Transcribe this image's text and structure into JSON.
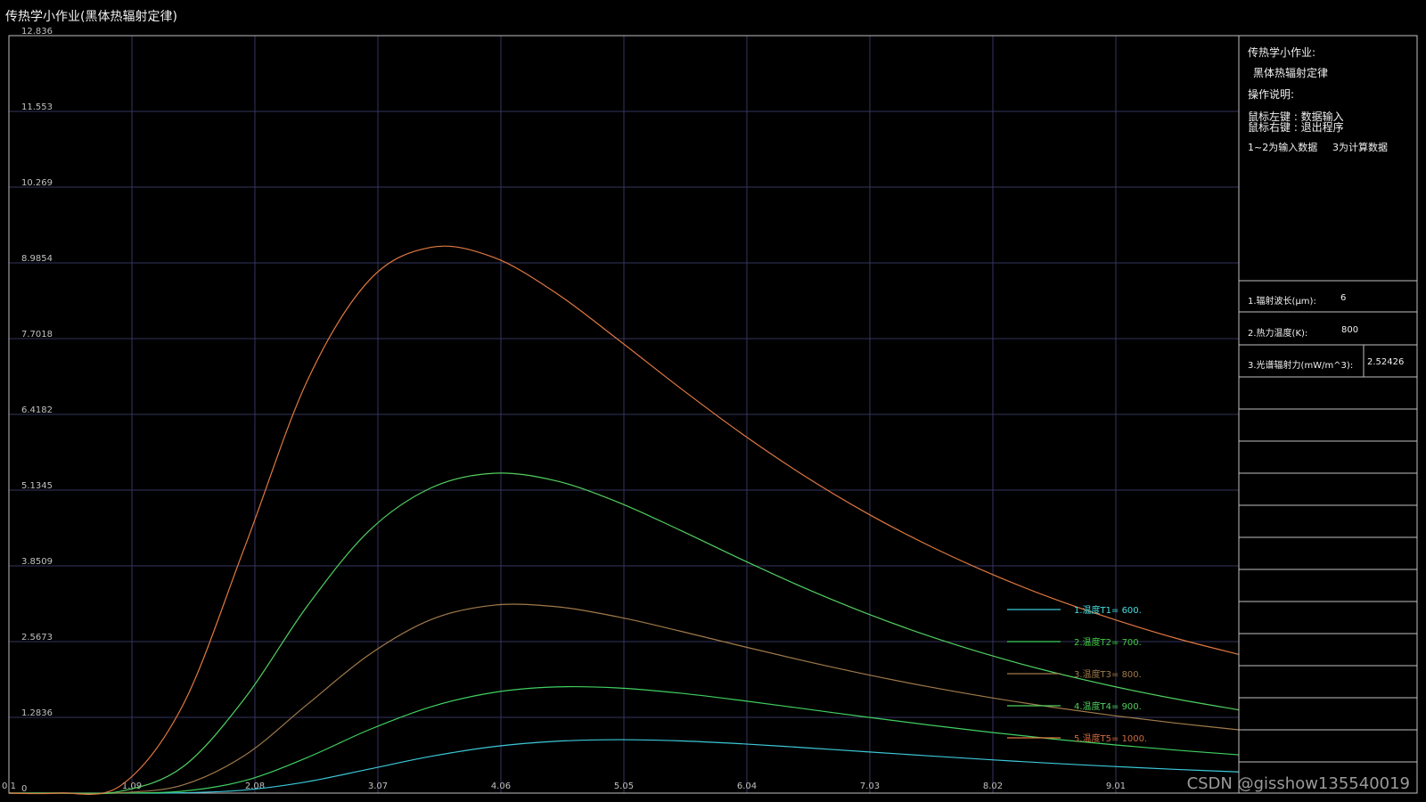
{
  "window": {
    "title": "传热学小作业(黑体热辐射定律)"
  },
  "sidebar": {
    "heading": "传热学小作业:",
    "subheading": "黑体热辐射定律",
    "instructions_label": "操作说明:",
    "left_click": "鼠标左键  : 数据输入",
    "right_click": "鼠标右键  : 退出程序",
    "note_inputs": "1~2为输入数据",
    "note_calc": "3为计算数据",
    "fields": [
      {
        "label": "1.辐射波长(μm):",
        "value": "6"
      },
      {
        "label": "2.热力温度(K):",
        "value": "800"
      },
      {
        "label": "3.光谱辐射力(mW/m^3):",
        "value": "2.52426"
      }
    ]
  },
  "watermark": "CSDN @gisshow135540019",
  "colors": {
    "background": "#000000",
    "grid": "#353560",
    "axis": "#c0c0c0",
    "label": "#c0c0c0",
    "legend_text_1": "#47e0e0",
    "legend_text_2": "#40d040",
    "legend_text_3": "#a07a4a",
    "legend_text_4": "#50d060",
    "legend_text_5": "#d06a40"
  },
  "chart_data": {
    "type": "line",
    "title": "",
    "xlabel": "",
    "ylabel": "",
    "xlim": [
      0.1,
      10.0
    ],
    "ylim": [
      0,
      12.836
    ],
    "x_ticks": [
      "0.1",
      "1.09",
      "2.08",
      "3.07",
      "4.06",
      "5.05",
      "6.04",
      "7.03",
      "8.02",
      "9.01"
    ],
    "y_ticks": [
      "0",
      "1.2836",
      "2.5673",
      "3.8509",
      "5.1345",
      "6.4182",
      "7.7018",
      "8.9854",
      "10.269",
      "11.553",
      "12.836"
    ],
    "grid": true,
    "legend_position": "bottom-right",
    "series": [
      {
        "name": "1.温度T1=  600.",
        "temperature": 600,
        "color": "#3cc8d8",
        "x": [
          0.5,
          1.0,
          1.5,
          2.0,
          2.5,
          3.0,
          3.5,
          4.0,
          4.5,
          5.0,
          5.5,
          6.0,
          6.5,
          7.0,
          7.5,
          8.0,
          8.5,
          9.0,
          9.5,
          10.0
        ],
        "values": [
          0,
          6e-05,
          0.0051,
          0.0518,
          0.1918,
          0.4071,
          0.6234,
          0.787,
          0.8779,
          0.9051,
          0.8853,
          0.8351,
          0.7706,
          0.7007,
          0.6312,
          0.5653,
          0.5047,
          0.45,
          0.4013,
          0.3582
        ]
      },
      {
        "name": "2.温度T2=  700.",
        "temperature": 700,
        "color": "#40d060",
        "x": [
          0.5,
          1.0,
          1.5,
          2.0,
          2.5,
          3.0,
          3.5,
          4.0,
          4.5,
          5.0,
          5.5,
          6.0,
          6.5,
          7.0,
          7.5,
          8.0,
          8.5,
          9.0,
          9.5,
          10.0
        ],
        "values": [
          0,
          0.0008,
          0.0321,
          0.2117,
          0.601,
          1.074,
          1.4642,
          1.7049,
          1.7987,
          1.7818,
          1.694,
          1.5688,
          1.4295,
          1.2892,
          1.1551,
          1.0308,
          0.9179,
          0.8169,
          0.7275,
          0.6488
        ]
      },
      {
        "name": "3.温度T3=  800.",
        "temperature": 800,
        "color": "#a07a4a",
        "x": [
          0.5,
          1.0,
          1.5,
          2.0,
          2.5,
          3.0,
          3.5,
          4.0,
          4.5,
          5.0,
          5.5,
          6.0,
          6.5,
          7.0,
          7.5,
          8.0,
          8.5,
          9.0,
          9.5,
          10.0
        ],
        "values": [
          0,
          0.006,
          0.1376,
          0.642,
          1.4996,
          2.3471,
          2.9416,
          3.184,
          3.16,
          2.987,
          2.7467,
          2.4898,
          2.2412,
          2.0112,
          1.8035,
          1.6189,
          1.4554,
          1.3112,
          1.1841,
          1.0719
        ]
      },
      {
        "name": "4.温度T4=  900.",
        "temperature": 900,
        "color": "#50d060",
        "x": [
          0.5,
          1.0,
          1.5,
          2.0,
          2.5,
          3.0,
          3.5,
          4.0,
          4.5,
          5.0,
          5.5,
          6.0,
          6.5,
          7.0,
          7.5,
          8.0,
          8.5,
          9.0,
          9.5,
          10.0
        ],
        "values": [
          0,
          0.0311,
          0.4449,
          1.6101,
          3.1658,
          4.4468,
          5.1743,
          5.42,
          5.2936,
          4.9323,
          4.4578,
          3.958,
          3.4798,
          3.0475,
          2.6663,
          2.3354,
          2.0501,
          1.8047,
          1.593,
          1.4101
        ]
      },
      {
        "name": "5.温度T5=  1000.",
        "temperature": 1000,
        "color": "#e07840",
        "x": [
          0.5,
          1.0,
          1.5,
          2.0,
          2.5,
          3.0,
          3.5,
          4.0,
          4.5,
          5.0,
          5.5,
          6.0,
          6.5,
          7.0,
          7.5,
          8.0,
          8.5,
          9.0,
          9.5,
          10.0
        ],
        "values": [
          0,
          0.1275,
          1.489,
          4.18,
          6.98,
          8.69,
          9.25,
          9.08,
          8.48,
          7.69,
          6.87,
          6.09,
          5.38,
          4.75,
          4.2,
          3.72,
          3.3,
          2.94,
          2.62,
          2.35
        ]
      }
    ]
  }
}
